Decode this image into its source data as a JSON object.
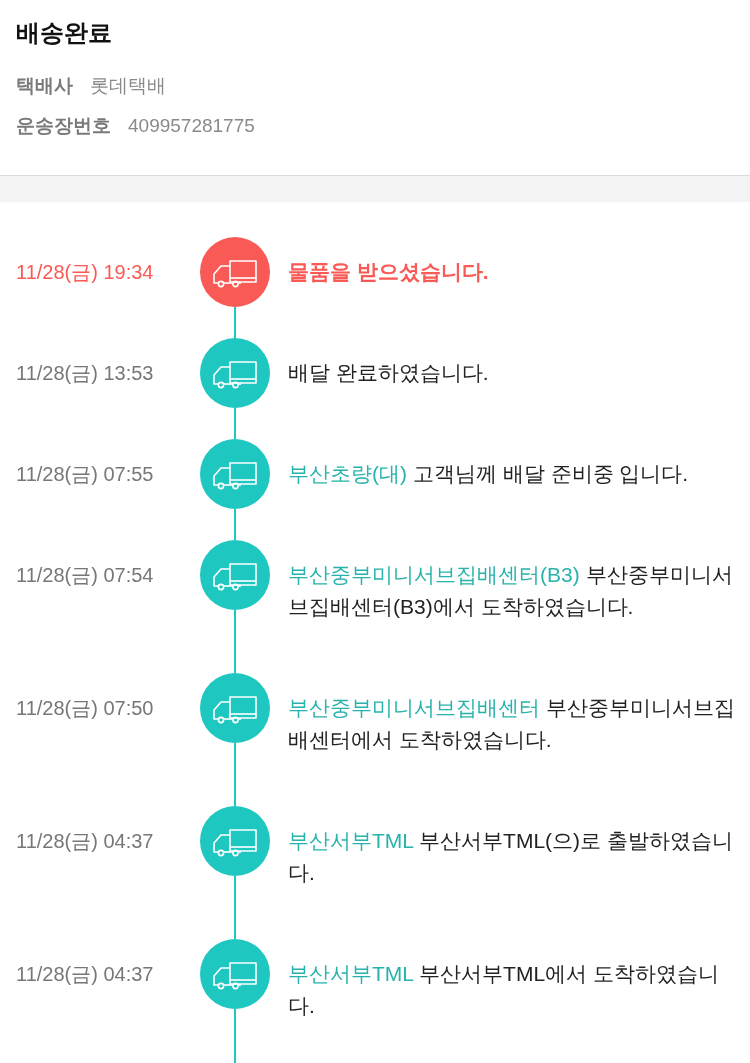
{
  "header": {
    "title": "배송완료",
    "fields": [
      {
        "label": "택배사",
        "value": "롯데택배"
      },
      {
        "label": "운송장번호",
        "value": "409957281775"
      }
    ]
  },
  "timeline": [
    {
      "time": "11/28(금) 19:34",
      "current": true,
      "message": "물품을 받으셨습니다."
    },
    {
      "time": "11/28(금) 13:53",
      "current": false,
      "message": "배달 완료하였습니다."
    },
    {
      "time": "11/28(금) 07:55",
      "current": false,
      "location": "부산초량(대)",
      "message": "고객님께 배달 준비중 입니다."
    },
    {
      "time": "11/28(금) 07:54",
      "current": false,
      "location": "부산중부미니서브집배센터(B3)",
      "message": "부산중부미니서브집배센터(B3)에서 도착하였습니다."
    },
    {
      "time": "11/28(금) 07:50",
      "current": false,
      "location": "부산중부미니서브집배센터",
      "message": "부산중부미니서브집배센터에서 도착하였습니다."
    },
    {
      "time": "11/28(금) 04:37",
      "current": false,
      "location": "부산서부TML",
      "message": "부산서부TML(으)로 출발하였습니다."
    },
    {
      "time": "11/28(금) 04:37",
      "current": false,
      "location": "부산서부TML",
      "message": "부산서부TML에서 도착하였습니다."
    }
  ]
}
